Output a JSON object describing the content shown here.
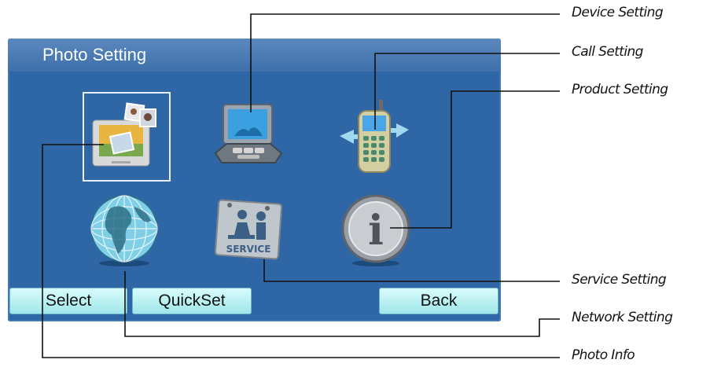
{
  "screen": {
    "title": "Photo Setting",
    "icons": [
      {
        "id": "photo",
        "icon": "photo-frame-icon",
        "selected": true
      },
      {
        "id": "device",
        "icon": "laptop-icon",
        "selected": false
      },
      {
        "id": "call",
        "icon": "mobile-phone-icon",
        "selected": false
      },
      {
        "id": "network",
        "icon": "globe-icon",
        "selected": false
      },
      {
        "id": "service",
        "icon": "service-sign-icon",
        "selected": false,
        "label": "SERVICE"
      },
      {
        "id": "product",
        "icon": "info-icon",
        "selected": false,
        "label": "i"
      }
    ],
    "buttons": {
      "select": "Select",
      "quickset": "QuickSet",
      "back": "Back"
    }
  },
  "callouts": {
    "device": "Device Setting",
    "call": "Call Setting",
    "product": "Product Setting",
    "service": "Service Setting",
    "network": "Network Setting",
    "photo_info": "Photo Info"
  },
  "colors": {
    "screen_bg": "#2f67a6",
    "titlebar": "#4a7cb6",
    "button": "#b8f1f3",
    "callout_line": "#111111"
  }
}
